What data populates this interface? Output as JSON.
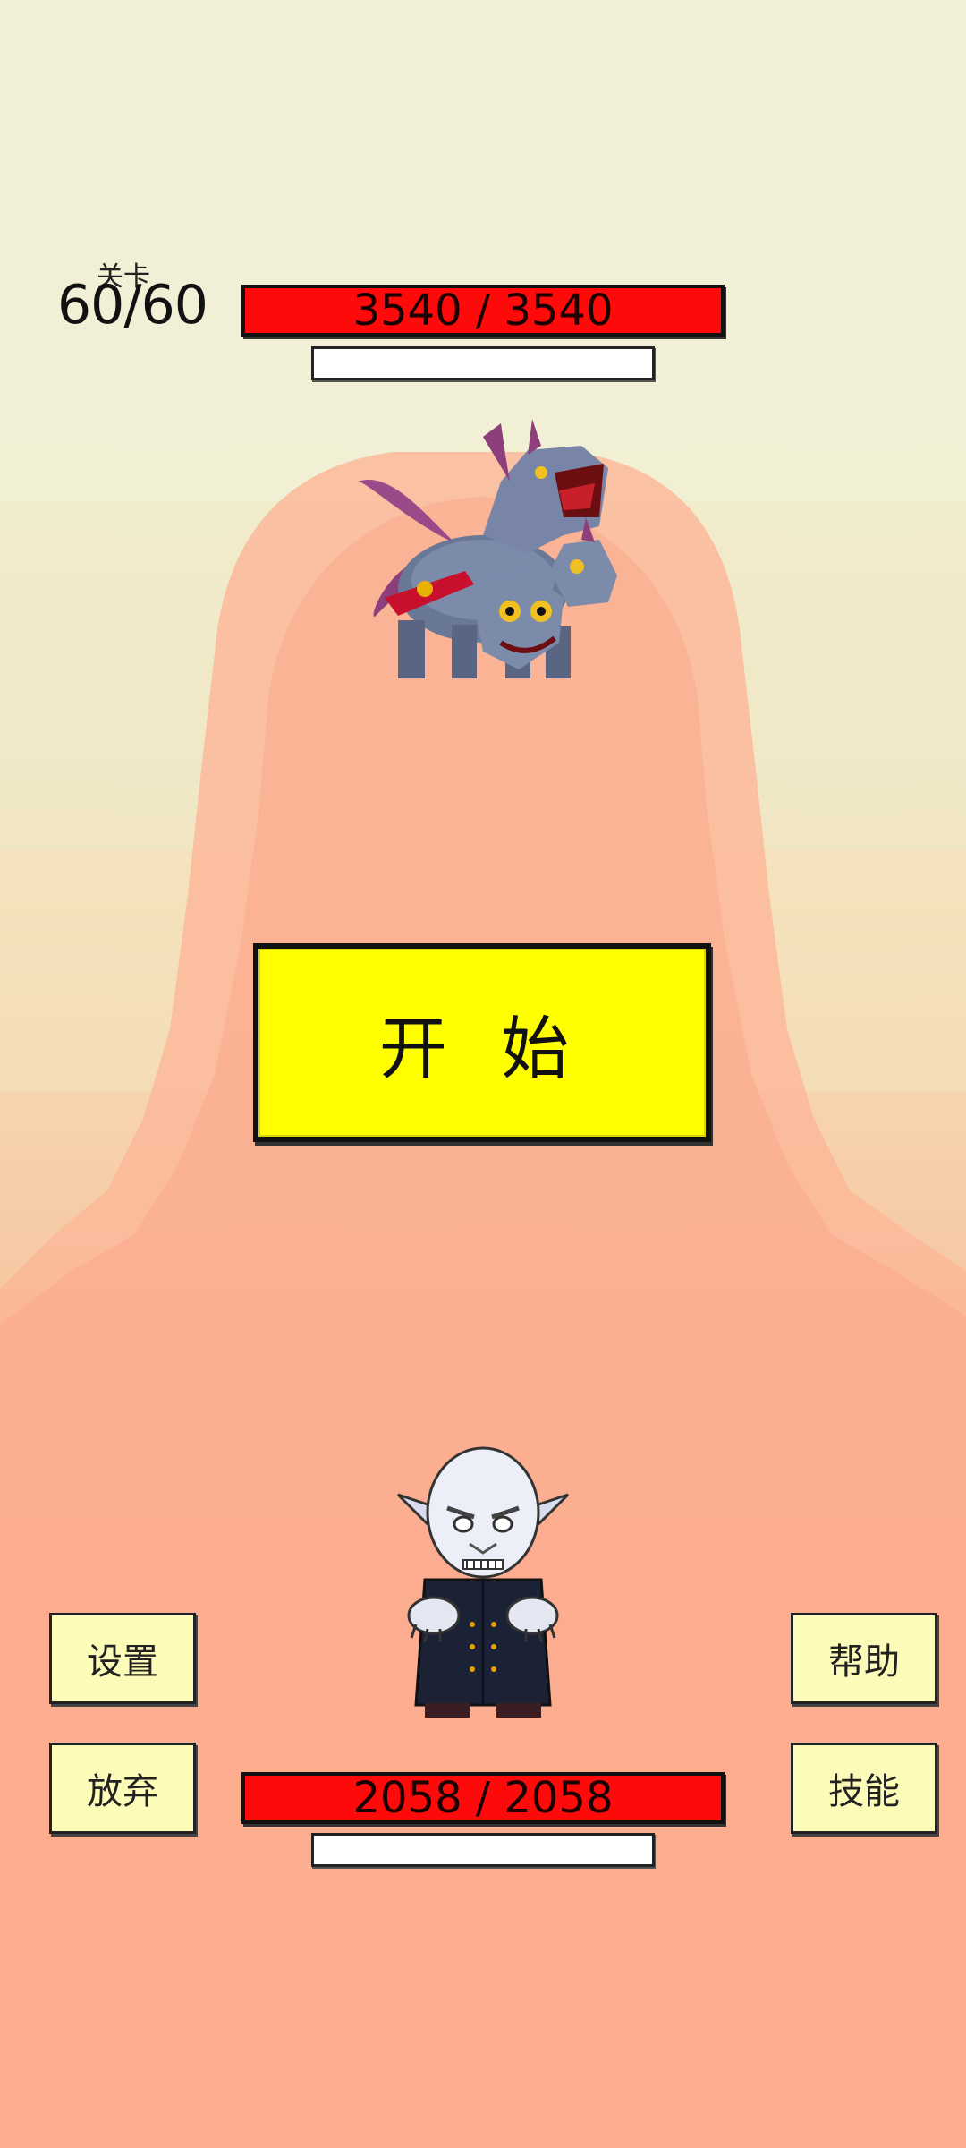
{
  "level": {
    "label": "关卡",
    "value": "60/60"
  },
  "enemy": {
    "hp_text": "3540 / 3540",
    "sprite": "three-headed-dragon-beast"
  },
  "player": {
    "hp_text": "2058 / 2058",
    "sprite": "pale-vampire"
  },
  "buttons": {
    "start": "开 始",
    "settings": "设置",
    "give_up": "放弃",
    "help": "帮助",
    "skills": "技能"
  },
  "colors": {
    "hp_bar": "#ff0a0a",
    "start_button": "#ffff00",
    "side_button": "#fdfbb8"
  }
}
